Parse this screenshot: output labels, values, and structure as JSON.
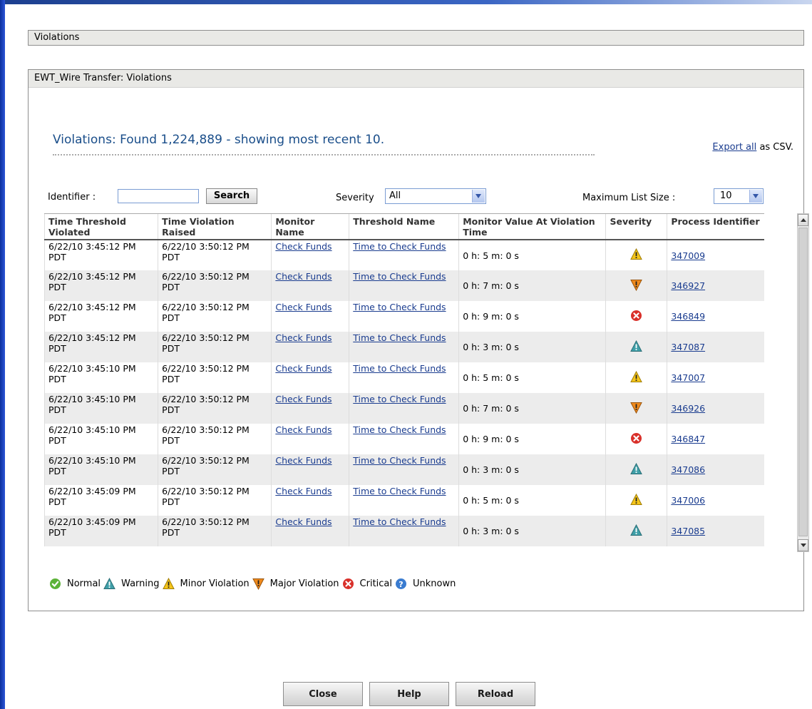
{
  "panel": {
    "title": "Violations",
    "subtitle": "EWT_Wire Transfer: Violations"
  },
  "summary": {
    "text": "Violations: Found 1,224,889 - showing most recent 10.",
    "export_link": "Export all",
    "export_suffix": "as CSV."
  },
  "filters": {
    "identifier_label": "Identifier :",
    "identifier_value": "",
    "search_label": "Search",
    "severity_label": "Severity",
    "severity_value": "All",
    "max_size_label": "Maximum List Size :",
    "max_size_value": "10"
  },
  "table": {
    "headers": {
      "time_threshold": "Time Threshold Violated",
      "time_raised": "Time Violation Raised",
      "monitor": "Monitor Name",
      "threshold": "Threshold Name",
      "value": "Monitor Value At Violation Time",
      "severity": "Severity",
      "pid": "Process Identifier"
    },
    "rows": [
      {
        "violated": "6/22/10 3:45:12 PM PDT",
        "raised": "6/22/10 3:50:12 PM PDT",
        "monitor": "Check Funds",
        "threshold": "Time to Check Funds",
        "value": "0 h: 5 m: 0 s",
        "severity": "minor",
        "pid": "347009"
      },
      {
        "violated": "6/22/10 3:45:12 PM PDT",
        "raised": "6/22/10 3:50:12 PM PDT",
        "monitor": "Check Funds",
        "threshold": "Time to Check Funds",
        "value": "0 h: 7 m: 0 s",
        "severity": "major",
        "pid": "346927"
      },
      {
        "violated": "6/22/10 3:45:12 PM PDT",
        "raised": "6/22/10 3:50:12 PM PDT",
        "monitor": "Check Funds",
        "threshold": "Time to Check Funds",
        "value": "0 h: 9 m: 0 s",
        "severity": "critical",
        "pid": "346849"
      },
      {
        "violated": "6/22/10 3:45:12 PM PDT",
        "raised": "6/22/10 3:50:12 PM PDT",
        "monitor": "Check Funds",
        "threshold": "Time to Check Funds",
        "value": "0 h: 3 m: 0 s",
        "severity": "warning",
        "pid": "347087"
      },
      {
        "violated": "6/22/10 3:45:10 PM PDT",
        "raised": "6/22/10 3:50:12 PM PDT",
        "monitor": "Check Funds",
        "threshold": "Time to Check Funds",
        "value": "0 h: 5 m: 0 s",
        "severity": "minor",
        "pid": "347007"
      },
      {
        "violated": "6/22/10 3:45:10 PM PDT",
        "raised": "6/22/10 3:50:12 PM PDT",
        "monitor": "Check Funds",
        "threshold": "Time to Check Funds",
        "value": "0 h: 7 m: 0 s",
        "severity": "major",
        "pid": "346926"
      },
      {
        "violated": "6/22/10 3:45:10 PM PDT",
        "raised": "6/22/10 3:50:12 PM PDT",
        "monitor": "Check Funds",
        "threshold": "Time to Check Funds",
        "value": "0 h: 9 m: 0 s",
        "severity": "critical",
        "pid": "346847"
      },
      {
        "violated": "6/22/10 3:45:10 PM PDT",
        "raised": "6/22/10 3:50:12 PM PDT",
        "monitor": "Check Funds",
        "threshold": "Time to Check Funds",
        "value": "0 h: 3 m: 0 s",
        "severity": "warning",
        "pid": "347086"
      },
      {
        "violated": "6/22/10 3:45:09 PM PDT",
        "raised": "6/22/10 3:50:12 PM PDT",
        "monitor": "Check Funds",
        "threshold": "Time to Check Funds",
        "value": "0 h: 5 m: 0 s",
        "severity": "minor",
        "pid": "347006"
      },
      {
        "violated": "6/22/10 3:45:09 PM PDT",
        "raised": "6/22/10 3:50:12 PM PDT",
        "monitor": "Check Funds",
        "threshold": "Time to Check Funds",
        "value": "0 h: 3 m: 0 s",
        "severity": "warning",
        "pid": "347085"
      }
    ]
  },
  "legend": {
    "normal": "Normal",
    "warning": "Warning",
    "minor": "Minor Violation",
    "major": "Major Violation",
    "critical": "Critical",
    "unknown": "Unknown"
  },
  "icons": {
    "normal": "normal-check-icon",
    "warning": "warning-triangle-icon",
    "minor": "minor-violation-icon",
    "major": "major-violation-icon",
    "critical": "critical-x-icon",
    "unknown": "unknown-question-icon"
  },
  "colors": {
    "normal": "#5cb338",
    "warning": "#3f9fa8",
    "minor": "#f5c51a",
    "major": "#f08a1d",
    "critical": "#d9302a",
    "unknown": "#3a7cd0",
    "link": "#1a3c8f",
    "summary_text": "#1a4e8a"
  },
  "buttons": {
    "close": "Close",
    "help": "Help",
    "reload": "Reload"
  }
}
